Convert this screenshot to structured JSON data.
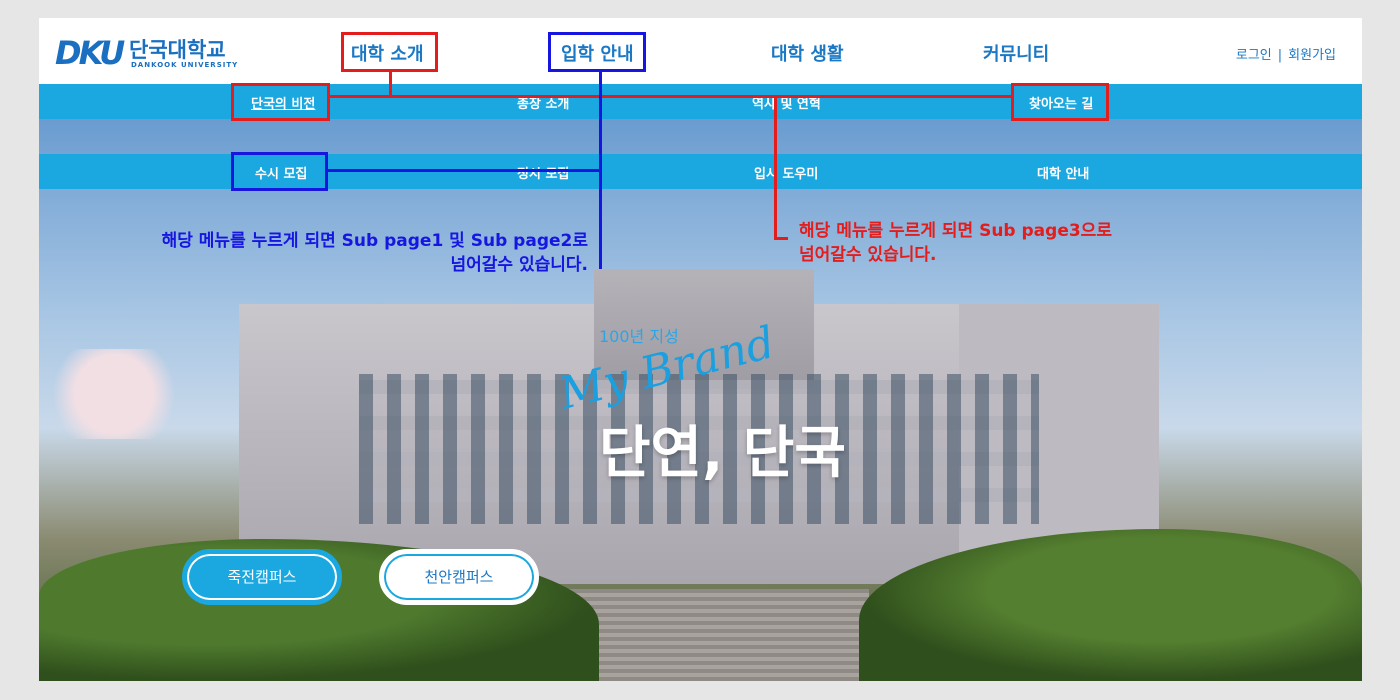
{
  "logo": {
    "mark": "DKU",
    "name_ko": "단국대학교",
    "name_en": "DANKOOK UNIVERSITY"
  },
  "nav": {
    "items": [
      {
        "label": "대학 소개"
      },
      {
        "label": "입학 안내"
      },
      {
        "label": "대학 생활"
      },
      {
        "label": "커뮤니티"
      }
    ]
  },
  "auth": {
    "login": "로그인",
    "separator": "|",
    "signup": "회원가입"
  },
  "submenu_about": {
    "items": [
      {
        "label": "단국의 비전"
      },
      {
        "label": "총장 소개"
      },
      {
        "label": "역사 및 연혁"
      },
      {
        "label": "찾아오는 길"
      }
    ]
  },
  "submenu_admission": {
    "items": [
      {
        "label": "수시 모집"
      },
      {
        "label": "정시 모집"
      },
      {
        "label": "입시 도우미"
      },
      {
        "label": "대학 안내"
      }
    ]
  },
  "hero": {
    "tag_small": "100년 지성",
    "tag_script": "My Brand",
    "headline": "단연, 단국"
  },
  "campus_buttons": {
    "jukjeon": "죽전캠퍼스",
    "cheonan": "천안캠퍼스"
  },
  "annotations": {
    "blue_note_line1": "해당 메뉴를 누르게 되면 Sub page1 및 Sub page2로",
    "blue_note_line2": "넘어갈수 있습니다.",
    "red_note_line1": "해당 메뉴를 누르게 되면 Sub page3으로",
    "red_note_line2": "넘어갈수 있습니다."
  },
  "colors": {
    "brand_blue": "#1b78c4",
    "sub_bar": "#1ba8e0",
    "annotation_red": "#e31c1c",
    "annotation_blue": "#1616e0"
  }
}
